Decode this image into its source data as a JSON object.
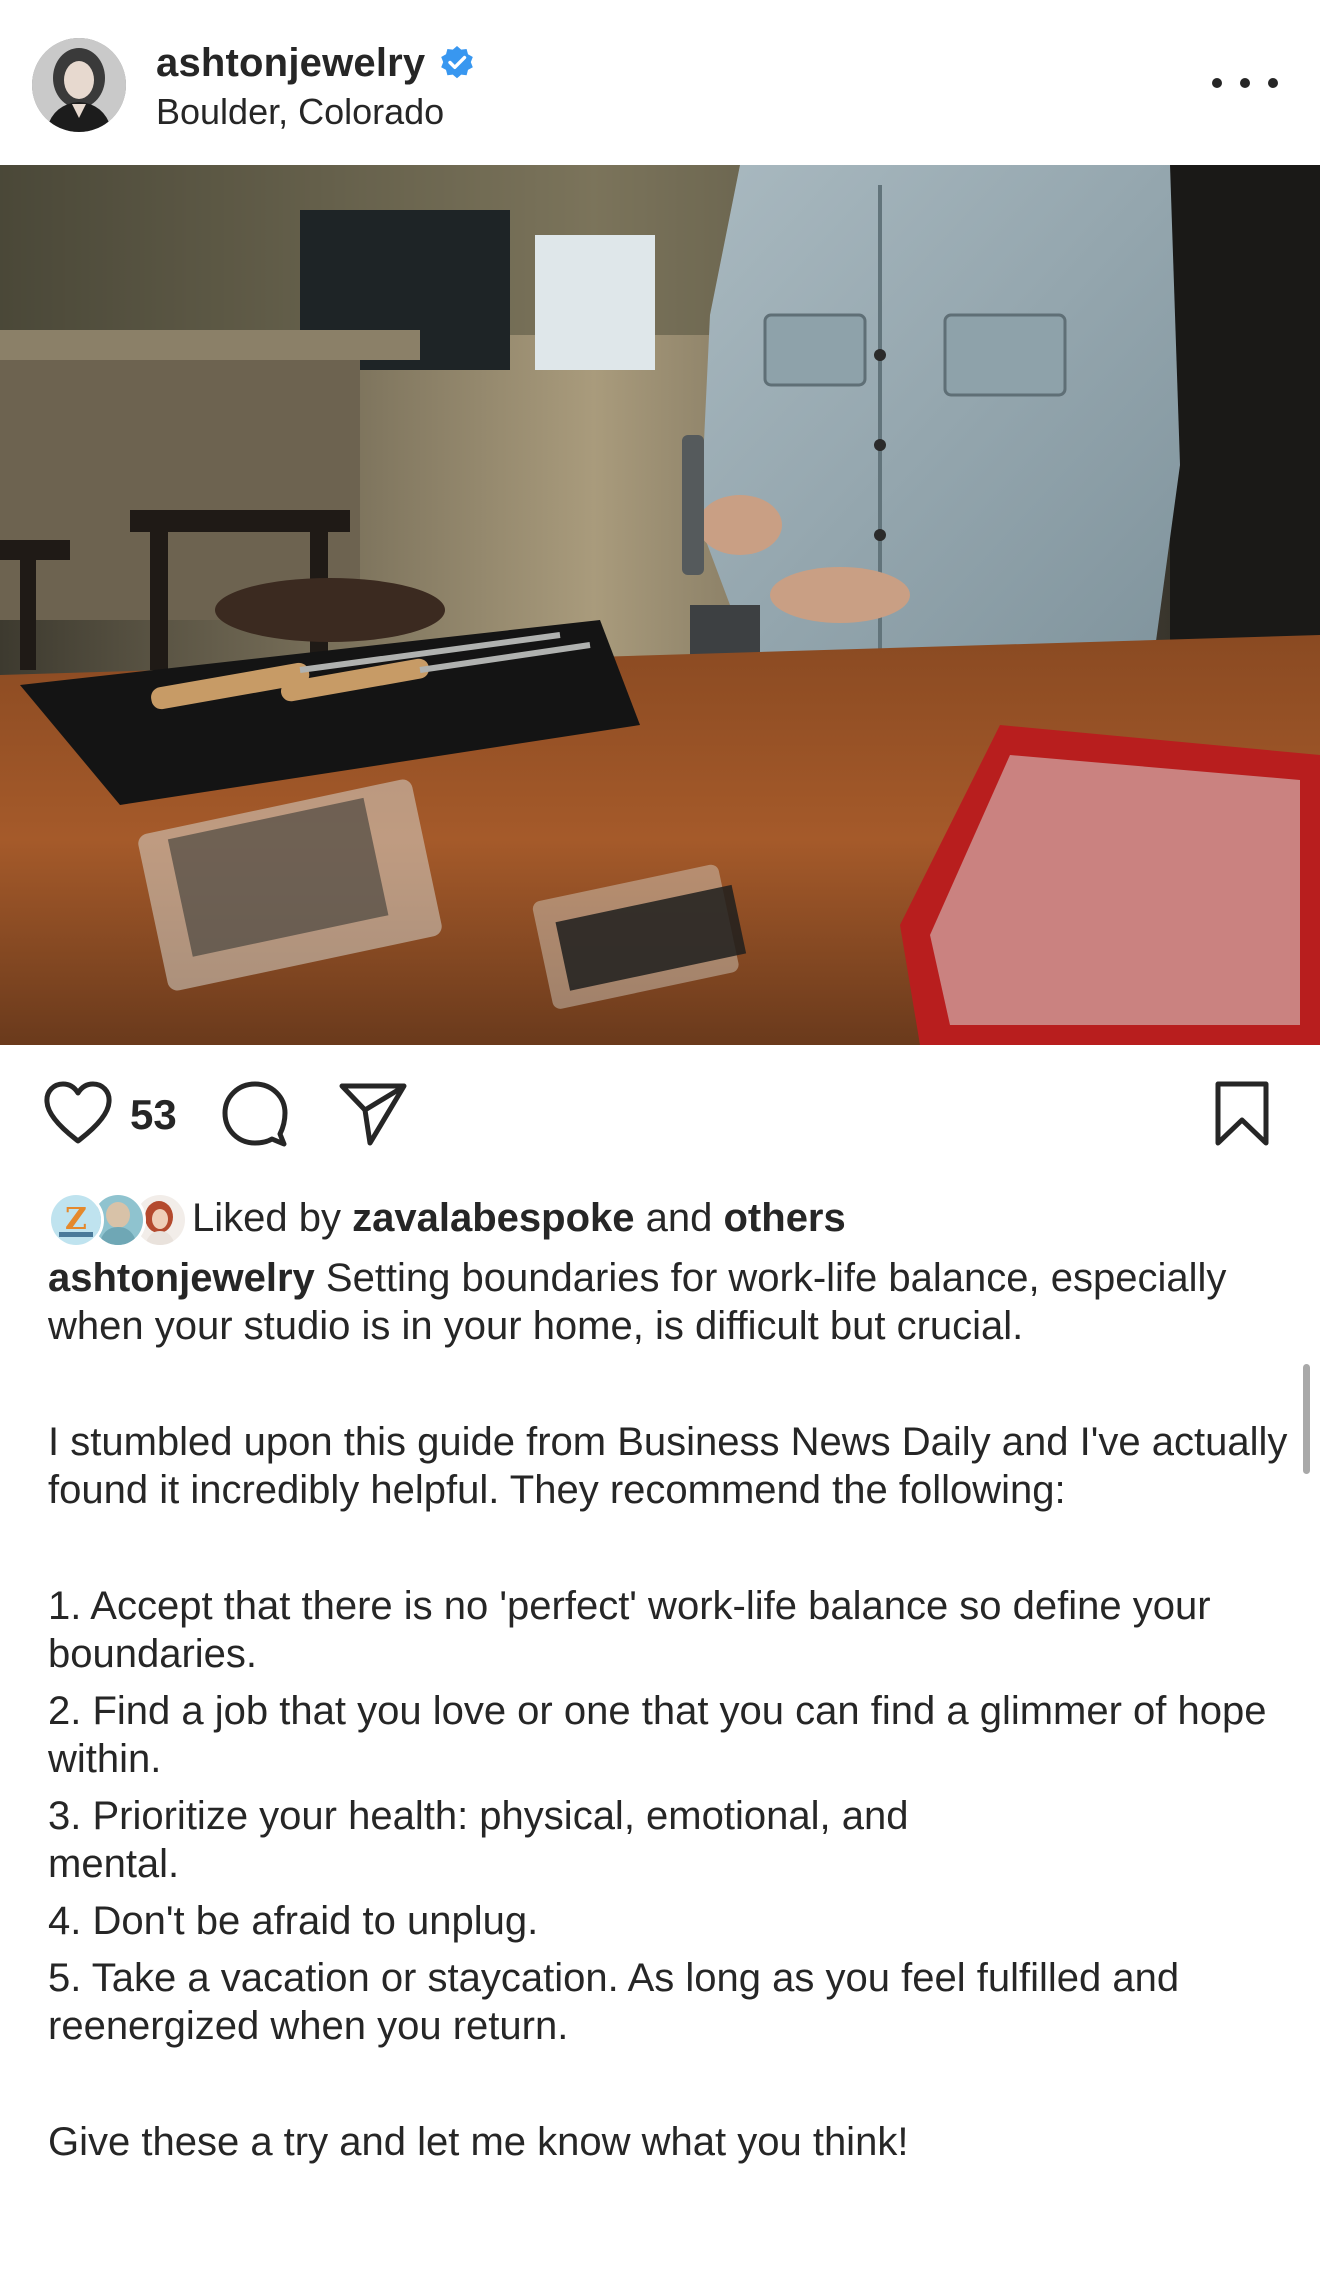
{
  "header": {
    "username": "ashtonjewelry",
    "verified_icon": "verified-badge-icon",
    "location": "Boulder, Colorado",
    "more_icon": "more-options-icon"
  },
  "post": {
    "image_subject": "workshop-photo",
    "likes_count": "53",
    "liked_by_prefix": "Liked by",
    "liked_by_user": "zavalabespoke",
    "liked_by_conjunction": "and",
    "liked_by_others": "others",
    "caption": {
      "username": "ashtonjewelry",
      "intro": "Setting boundaries for work-life balance, especially when your studio is in your home, is difficult but crucial.",
      "paragraph2": "I stumbled upon this guide from Business News Daily and I've actually found it incredibly helpful. They recommend the following:",
      "list": [
        "1. Accept that there is no 'perfect' work-life balance so define your boundaries.",
        "2. Find a job that you love or one that you can find a glimmer of hope within.",
        "3. Prioritize your health: physical, emotional, and",
        "mental.",
        "4. Don't be afraid to unplug.",
        "5. Take a vacation or staycation. As long as you feel fulfilled and reenergized when you return."
      ],
      "closing": "Give these a try and let me know what you think!"
    }
  },
  "actions": {
    "like_icon": "heart-icon",
    "comment_icon": "comment-icon",
    "share_icon": "paper-plane-icon",
    "save_icon": "bookmark-icon"
  },
  "colors": {
    "verified_blue": "#3897f0",
    "text": "#262626",
    "background": "#ffffff"
  }
}
